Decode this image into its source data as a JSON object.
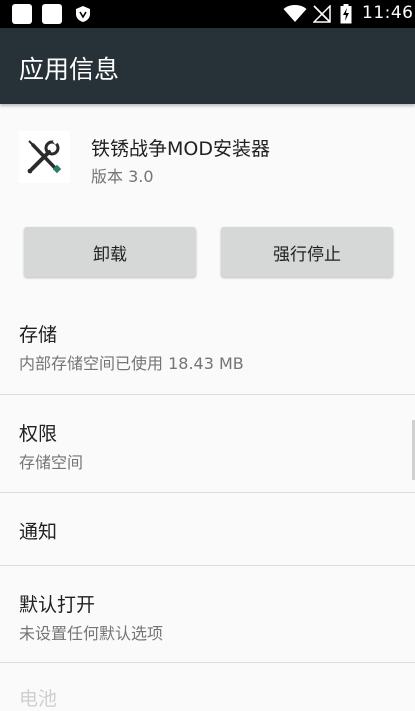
{
  "status_bar": {
    "time": "11:46",
    "left_icons": [
      "notification-square-icon",
      "notification-square-icon",
      "shield-icon"
    ],
    "right_icons": [
      "wifi-icon",
      "no-signal-icon",
      "battery-charging-icon"
    ]
  },
  "app_bar": {
    "title": "应用信息",
    "background": "#263238"
  },
  "app": {
    "name": "铁锈战争MOD安装器",
    "version": "版本 3.0",
    "icon": "tools-icon"
  },
  "buttons": {
    "uninstall": "卸载",
    "force_stop": "强行停止"
  },
  "sections": [
    {
      "title": "存储",
      "summary": "内部存储空间已使用 18.43 MB"
    },
    {
      "title": "权限",
      "summary": "存储空间"
    },
    {
      "title": "通知",
      "summary": ""
    },
    {
      "title": "默认打开",
      "summary": "未设置任何默认选项"
    }
  ],
  "partial_next_section": "电池"
}
